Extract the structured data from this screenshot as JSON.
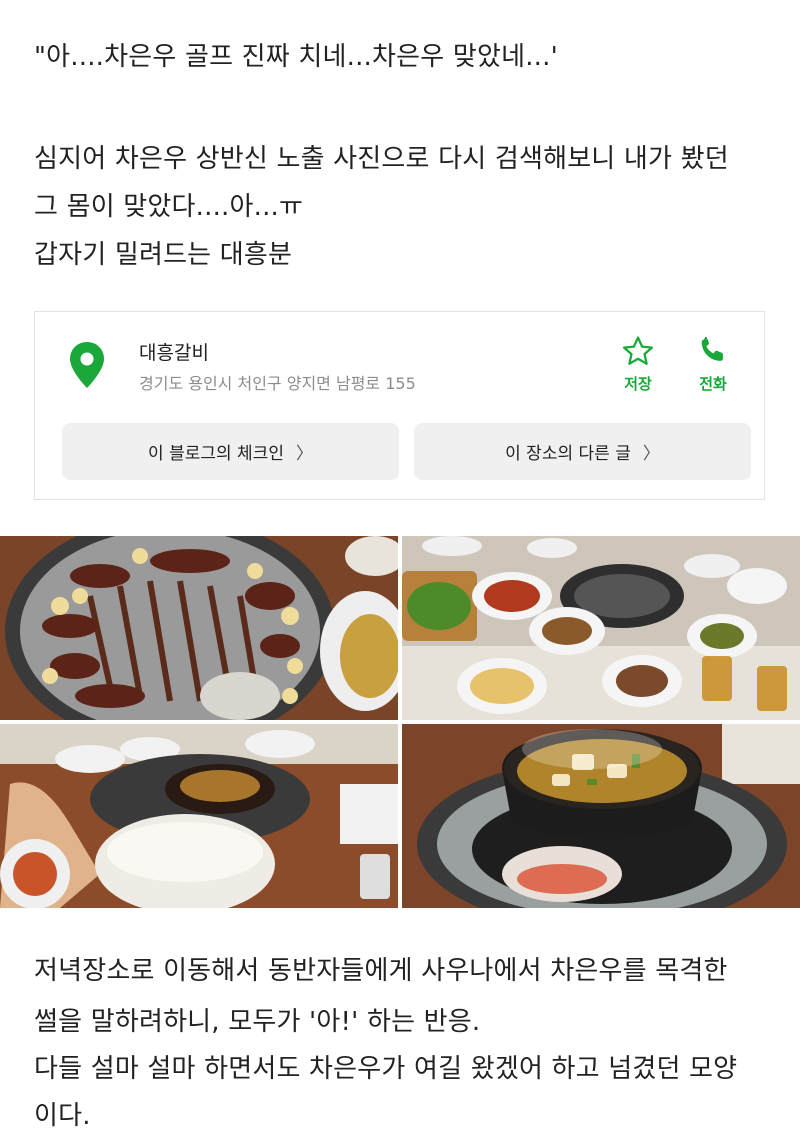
{
  "intro": {
    "line1": "\"아....차은우 골프 진짜 치네...차은우 맞았네...'",
    "line2": "심지어 차은우 상반신 노출 사진으로 다시 검색해보니 내가 봤던",
    "line3": "그 몸이 맞았다....아...ㅠ",
    "line4": "갑자기 밀려드는 대흥분"
  },
  "place": {
    "name": "대흥갈비",
    "address": "경기도 용인시 처인구 양지면 남평로 155",
    "save_label": "저장",
    "call_label": "전화",
    "checkin_label": "이 블로그의 체크인",
    "other_posts_label": "이 장소의 다른 글",
    "chevron": "〉",
    "accent_color": "#1aa83a",
    "pin_icon": "map-pin-icon",
    "save_icon": "star-icon",
    "call_icon": "phone-icon"
  },
  "photos": {
    "p1": "grill-meat-photo",
    "p2": "side-dishes-photo",
    "p3": "rice-bowl-photo",
    "p4": "stew-pot-photo"
  },
  "outro": {
    "line1": "저녁장소로 이동해서 동반자들에게 사우나에서 차은우를 목격한",
    "line2": "썰을 말하려하니, 모두가 '아!' 하는 반응.",
    "line3": "다들 설마 설마 하면서도 차은우가 여길 왔겠어 하고 넘겼던 모양",
    "line4": "이다."
  }
}
